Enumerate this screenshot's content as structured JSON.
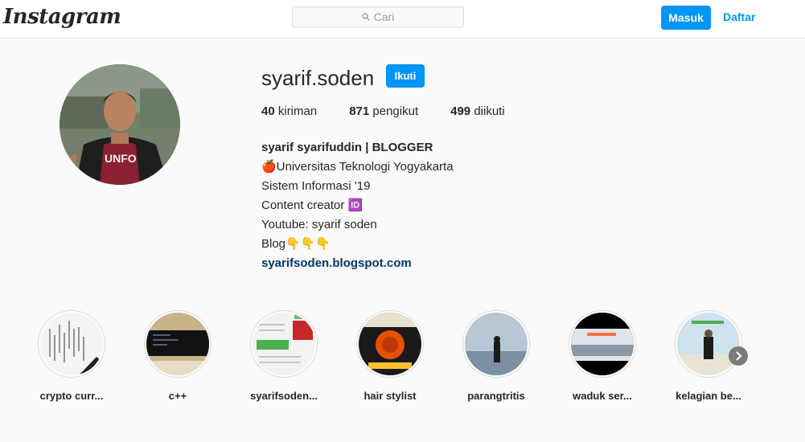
{
  "header": {
    "logo_text": "Instagram",
    "search_placeholder": "Cari",
    "login_label": "Masuk",
    "signup_label": "Daftar"
  },
  "profile": {
    "username": "syarif.soden",
    "follow_label": "Ikuti",
    "stats": {
      "posts_count": "40",
      "posts_label": "kiriman",
      "followers_count": "871",
      "followers_label": "pengikut",
      "following_count": "499",
      "following_label": "diikuti"
    },
    "full_name": "syarif syarifuddin | BLOGGER",
    "bio_lines": [
      "🍎Universitas Teknologi Yogyakarta",
      "Sistem Informasi '19",
      "Content creator 🆔",
      "Youtube: syarif soden",
      "Blog👇👇👇"
    ],
    "link": "syarifsoden.blogspot.com"
  },
  "highlights": [
    {
      "label": "crypto curr..."
    },
    {
      "label": "c++"
    },
    {
      "label": "syarifsoden..."
    },
    {
      "label": "hair stylist"
    },
    {
      "label": "parangtritis"
    },
    {
      "label": "waduk ser..."
    },
    {
      "label": "kelagian be..."
    }
  ],
  "colors": {
    "accent": "#0095f6",
    "link": "#00376b",
    "background": "#fafafa"
  }
}
